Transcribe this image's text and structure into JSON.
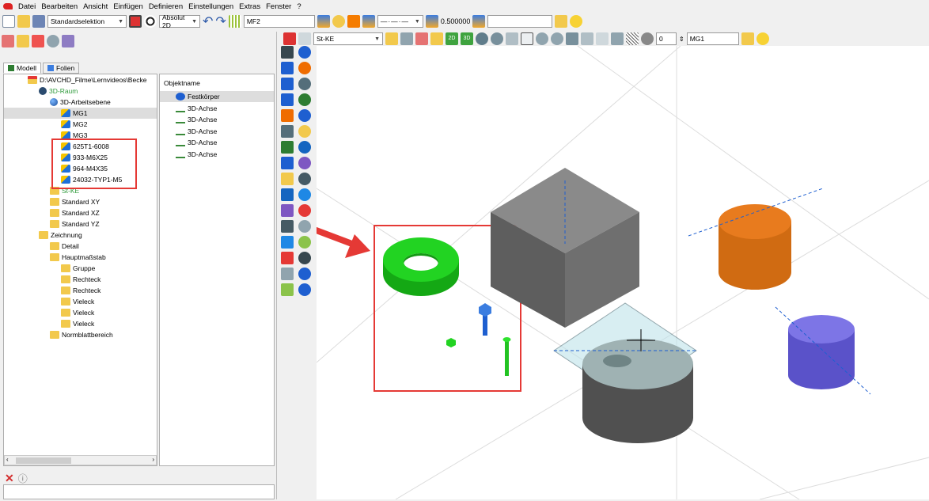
{
  "menu": [
    "Datei",
    "Bearbeiten",
    "Ansicht",
    "Einfügen",
    "Definieren",
    "Einstellungen",
    "Extras",
    "Fenster",
    "?"
  ],
  "toolbar1": {
    "selection": "Standardselektion",
    "coord_mode": "Absolut 2D",
    "layer_field": "MF2",
    "line_weight": "0.500000"
  },
  "toolbar2": {
    "material": "St-KE",
    "step_value": "0",
    "group_field": "MG1"
  },
  "tabs": {
    "model": "Modell",
    "layers": "Folien"
  },
  "tree": [
    {
      "label": "D:\\AVCHD_Filme\\Lernvideos\\Becke",
      "level": 0,
      "icon": "folder-red",
      "color": "#000"
    },
    {
      "label": "3D-Raum",
      "level": 1,
      "icon": "sphere-dark",
      "color": "#2e9a3a"
    },
    {
      "label": "3D-Arbeitsebene",
      "level": 2,
      "icon": "sphere",
      "color": "#000"
    },
    {
      "label": "MG1",
      "level": 3,
      "icon": "mg",
      "color": "#000",
      "selected": true
    },
    {
      "label": "MG2",
      "level": 3,
      "icon": "mg",
      "color": "#000"
    },
    {
      "label": "MG3",
      "level": 3,
      "icon": "mg",
      "color": "#000"
    },
    {
      "label": "625T1-6008",
      "level": 3,
      "icon": "mg",
      "color": "#000"
    },
    {
      "label": "933-M6X25",
      "level": 3,
      "icon": "mg",
      "color": "#000"
    },
    {
      "label": "964-M4X35",
      "level": 3,
      "icon": "mg",
      "color": "#000"
    },
    {
      "label": "24032-TYP1-M5",
      "level": 3,
      "icon": "mg",
      "color": "#000"
    },
    {
      "label": "St-KE",
      "level": 2,
      "icon": "folder",
      "color": "#2e9a3a"
    },
    {
      "label": "Standard XY",
      "level": 2,
      "icon": "folder",
      "color": "#000"
    },
    {
      "label": "Standard XZ",
      "level": 2,
      "icon": "folder",
      "color": "#000"
    },
    {
      "label": "Standard YZ",
      "level": 2,
      "icon": "folder",
      "color": "#000"
    },
    {
      "label": "Zeichnung",
      "level": 1,
      "icon": "folder-open",
      "color": "#000"
    },
    {
      "label": "Detail",
      "level": 2,
      "icon": "folder",
      "color": "#000"
    },
    {
      "label": "Hauptmaßstab",
      "level": 2,
      "icon": "folder",
      "color": "#000"
    },
    {
      "label": "Gruppe",
      "level": 3,
      "icon": "folder",
      "color": "#000"
    },
    {
      "label": "Rechteck",
      "level": 3,
      "icon": "folder",
      "color": "#000"
    },
    {
      "label": "Rechteck",
      "level": 3,
      "icon": "folder",
      "color": "#000"
    },
    {
      "label": "Vieleck",
      "level": 3,
      "icon": "folder",
      "color": "#000"
    },
    {
      "label": "Vieleck",
      "level": 3,
      "icon": "folder",
      "color": "#000"
    },
    {
      "label": "Vieleck",
      "level": 3,
      "icon": "folder",
      "color": "#000"
    },
    {
      "label": "Normblattbereich",
      "level": 2,
      "icon": "folder",
      "color": "#000"
    }
  ],
  "objects": {
    "header": "Objektname",
    "items": [
      {
        "label": "Festkörper",
        "icon": "solid-icon",
        "selected": true
      },
      {
        "label": "3D-Achse",
        "icon": "axis-icon"
      },
      {
        "label": "3D-Achse",
        "icon": "axis-icon"
      },
      {
        "label": "3D-Achse",
        "icon": "axis-icon"
      },
      {
        "label": "3D-Achse",
        "icon": "axis-icon"
      },
      {
        "label": "3D-Achse",
        "icon": "axis-icon"
      }
    ]
  },
  "colors": {
    "annotation_red": "#e53935",
    "washer_green": "#22d322",
    "cube_gray": "#7a7a7a",
    "cylinder_orange": "#e87b1e",
    "cylinder_blue": "#6c63d9",
    "bolt_blue": "#1e5fd0"
  }
}
